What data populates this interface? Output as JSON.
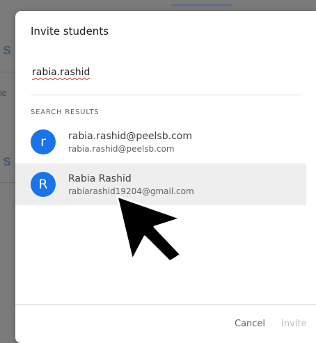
{
  "background": {
    "frag1": "s",
    "frag2": "ic",
    "frag3": "s"
  },
  "dialog": {
    "title": "Invite students",
    "search": {
      "value": "rabia.rashid"
    },
    "section_label": "SEARCH RESULTS",
    "results": [
      {
        "avatar_letter": "r",
        "name": "rabia.rashid@peelsb.com",
        "email": "rabia.rashid@peelsb.com",
        "highlighted": false
      },
      {
        "avatar_letter": "R",
        "name": "Rabia Rashid",
        "email": "rabiarashid19204@gmail.com",
        "highlighted": true
      }
    ],
    "footer": {
      "cancel_label": "Cancel",
      "invite_label": "Invite"
    }
  },
  "colors": {
    "avatar": "#1a73e8",
    "highlight_row": "#eeeeee",
    "overlay": "#7b7b7b"
  },
  "cursor": {
    "icon": "arrow-cursor-icon"
  }
}
